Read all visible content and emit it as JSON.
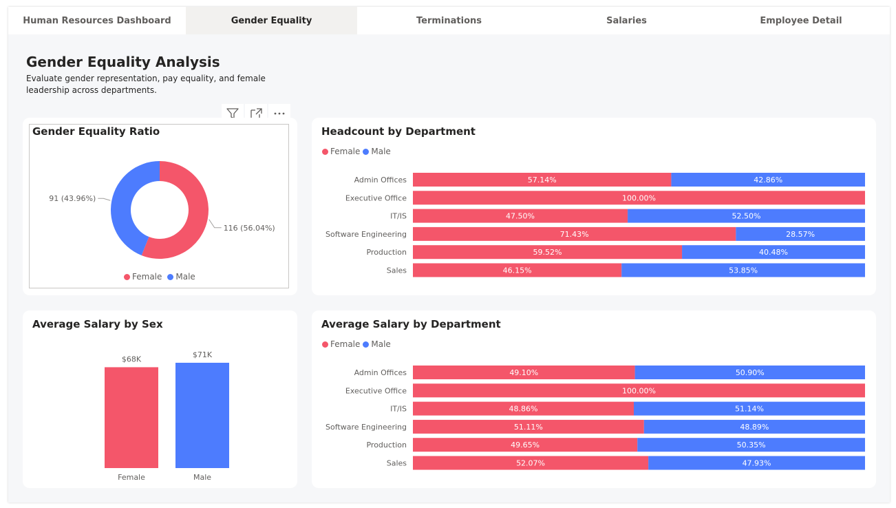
{
  "tabs": [
    {
      "label": "Human Resources Dashboard",
      "active": false
    },
    {
      "label": "Gender Equality",
      "active": true
    },
    {
      "label": "Terminations",
      "active": false
    },
    {
      "label": "Salaries",
      "active": false
    },
    {
      "label": "Employee Detail",
      "active": false
    }
  ],
  "page": {
    "title": "Gender Equality Analysis",
    "subtitle": "Evaluate gender representation, pay equality, and female leadership across departments."
  },
  "visual_header": {
    "icons": [
      "filter-icon",
      "focus-mode-icon",
      "more-options-icon"
    ]
  },
  "colors": {
    "female": "#f4566a",
    "male": "#4d7cfe"
  },
  "legend": {
    "female": "Female",
    "male": "Male"
  },
  "chart_data": [
    {
      "type": "pie",
      "variant": "donut",
      "title": "Gender Equality Ratio",
      "categories": [
        "Female",
        "Male"
      ],
      "values": [
        116,
        91
      ],
      "labels": [
        "116 (56.04%)",
        "91 (43.96%)"
      ],
      "legend_position": "bottom"
    },
    {
      "type": "bar",
      "variant": "100% stacked horizontal",
      "title": "Headcount by Department",
      "categories": [
        "Admin Offices",
        "Executive Office",
        "IT/IS",
        "Software Engineering",
        "Production",
        "Sales"
      ],
      "series": [
        {
          "name": "Female",
          "values": [
            57.14,
            100.0,
            47.5,
            71.43,
            59.52,
            46.15
          ],
          "labels": [
            "57.14%",
            "100.00%",
            "47.50%",
            "71.43%",
            "59.52%",
            "46.15%"
          ]
        },
        {
          "name": "Male",
          "values": [
            42.86,
            0,
            52.5,
            28.57,
            40.48,
            53.85
          ],
          "labels": [
            "42.86%",
            "",
            "52.50%",
            "28.57%",
            "40.48%",
            "53.85%"
          ]
        }
      ],
      "legend_position": "top-left"
    },
    {
      "type": "bar",
      "variant": "vertical",
      "title": "Average Salary by Sex",
      "categories": [
        "Female",
        "Male"
      ],
      "values": [
        68,
        71
      ],
      "labels": [
        "$68K",
        "$71K"
      ]
    },
    {
      "type": "bar",
      "variant": "100% stacked horizontal",
      "title": "Average Salary by Department",
      "categories": [
        "Admin Offices",
        "Executive Office",
        "IT/IS",
        "Software Engineering",
        "Production",
        "Sales"
      ],
      "series": [
        {
          "name": "Female",
          "values": [
            49.1,
            100.0,
            48.86,
            51.11,
            49.65,
            52.07
          ],
          "labels": [
            "49.10%",
            "100.00%",
            "48.86%",
            "51.11%",
            "49.65%",
            "52.07%"
          ]
        },
        {
          "name": "Male",
          "values": [
            50.9,
            0,
            51.14,
            48.89,
            50.35,
            47.93
          ],
          "labels": [
            "50.90%",
            "",
            "51.14%",
            "48.89%",
            "50.35%",
            "47.93%"
          ]
        }
      ],
      "legend_position": "top-left"
    }
  ]
}
